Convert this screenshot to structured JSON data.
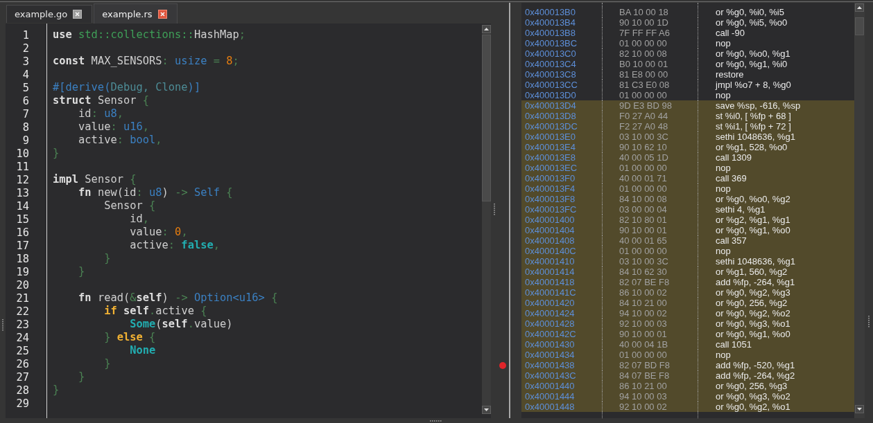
{
  "editor": {
    "tabs": [
      {
        "label": "example.go",
        "selected": false
      },
      {
        "label": "example.rs",
        "selected": true
      }
    ],
    "lines": [
      {
        "number": "1",
        "tokens": [
          {
            "kind": "keyword",
            "text": "use "
          },
          {
            "kind": "path",
            "text": "std::collections::"
          },
          {
            "kind": "plain",
            "text": "HashMap"
          },
          {
            "kind": "punct",
            "text": ";"
          }
        ]
      },
      {
        "number": "2"
      },
      {
        "number": "3",
        "tokens": [
          {
            "kind": "keyword",
            "text": "const"
          },
          {
            "kind": "plain",
            "text": " MAX_SENSORS"
          },
          {
            "kind": "punct",
            "text": ": "
          },
          {
            "kind": "type",
            "text": "usize"
          },
          {
            "kind": "punct",
            "text": " = "
          },
          {
            "kind": "number",
            "text": "8"
          },
          {
            "kind": "punct",
            "text": ";"
          }
        ]
      },
      {
        "number": "4"
      },
      {
        "number": "5",
        "tokens": [
          {
            "kind": "attribute",
            "text": "#[derive("
          },
          {
            "kind": "attr_arg",
            "text": "Debug, Clone"
          },
          {
            "kind": "attribute",
            "text": ")]"
          }
        ]
      },
      {
        "number": "6",
        "tokens": [
          {
            "kind": "keyword",
            "text": "struct"
          },
          {
            "kind": "plain",
            "text": " Sensor "
          },
          {
            "kind": "punct",
            "text": "{"
          }
        ]
      },
      {
        "number": "7",
        "tokens": [
          {
            "kind": "plain",
            "text": "    id"
          },
          {
            "kind": "punct",
            "text": ": "
          },
          {
            "kind": "type",
            "text": "u8"
          },
          {
            "kind": "punct",
            "text": ","
          }
        ]
      },
      {
        "number": "8",
        "tokens": [
          {
            "kind": "plain",
            "text": "    value"
          },
          {
            "kind": "punct",
            "text": ": "
          },
          {
            "kind": "type",
            "text": "u16"
          },
          {
            "kind": "punct",
            "text": ","
          }
        ]
      },
      {
        "number": "9",
        "tokens": [
          {
            "kind": "plain",
            "text": "    active"
          },
          {
            "kind": "punct",
            "text": ": "
          },
          {
            "kind": "type",
            "text": "bool"
          },
          {
            "kind": "punct",
            "text": ","
          }
        ]
      },
      {
        "number": "10",
        "tokens": [
          {
            "kind": "punct",
            "text": "}"
          }
        ]
      },
      {
        "number": "11"
      },
      {
        "number": "12",
        "tokens": [
          {
            "kind": "keyword",
            "text": "impl"
          },
          {
            "kind": "plain",
            "text": " Sensor "
          },
          {
            "kind": "punct",
            "text": "{"
          }
        ]
      },
      {
        "number": "13",
        "tokens": [
          {
            "kind": "keyword",
            "text": "    fn"
          },
          {
            "kind": "plain",
            "text": " new(id"
          },
          {
            "kind": "punct",
            "text": ": "
          },
          {
            "kind": "type",
            "text": "u8"
          },
          {
            "kind": "plain",
            "text": ")"
          },
          {
            "kind": "punct",
            "text": " -> "
          },
          {
            "kind": "type",
            "text": "Self"
          },
          {
            "kind": "punct",
            "text": " {"
          }
        ]
      },
      {
        "number": "14",
        "tokens": [
          {
            "kind": "plain",
            "text": "        Sensor "
          },
          {
            "kind": "punct",
            "text": "{"
          }
        ]
      },
      {
        "number": "15",
        "tokens": [
          {
            "kind": "plain",
            "text": "            id"
          },
          {
            "kind": "punct",
            "text": ","
          }
        ]
      },
      {
        "number": "16",
        "tokens": [
          {
            "kind": "plain",
            "text": "            value"
          },
          {
            "kind": "punct",
            "text": ": "
          },
          {
            "kind": "number",
            "text": "0"
          },
          {
            "kind": "punct",
            "text": ","
          }
        ]
      },
      {
        "number": "17",
        "tokens": [
          {
            "kind": "plain",
            "text": "            active"
          },
          {
            "kind": "punct",
            "text": ": "
          },
          {
            "kind": "literal",
            "text": "false"
          },
          {
            "kind": "punct",
            "text": ","
          }
        ]
      },
      {
        "number": "18",
        "tokens": [
          {
            "kind": "punct",
            "text": "        }"
          }
        ]
      },
      {
        "number": "19",
        "tokens": [
          {
            "kind": "punct",
            "text": "    }"
          }
        ]
      },
      {
        "number": "20"
      },
      {
        "number": "21",
        "tokens": [
          {
            "kind": "keyword",
            "text": "    fn"
          },
          {
            "kind": "plain",
            "text": " read("
          },
          {
            "kind": "punct",
            "text": "&"
          },
          {
            "kind": "keyword",
            "text": "self"
          },
          {
            "kind": "plain",
            "text": ")"
          },
          {
            "kind": "punct",
            "text": " -> "
          },
          {
            "kind": "type",
            "text": "Option<u16>"
          },
          {
            "kind": "punct",
            "text": " {"
          }
        ]
      },
      {
        "number": "22",
        "tokens": [
          {
            "kind": "control",
            "text": "        if "
          },
          {
            "kind": "keyword",
            "text": "self"
          },
          {
            "kind": "punct",
            "text": "."
          },
          {
            "kind": "plain",
            "text": "active "
          },
          {
            "kind": "punct",
            "text": "{"
          }
        ]
      },
      {
        "number": "23",
        "tokens": [
          {
            "kind": "literal",
            "text": "            Some"
          },
          {
            "kind": "plain",
            "text": "("
          },
          {
            "kind": "keyword",
            "text": "self"
          },
          {
            "kind": "punct",
            "text": "."
          },
          {
            "kind": "plain",
            "text": "value)"
          }
        ]
      },
      {
        "number": "24",
        "tokens": [
          {
            "kind": "punct",
            "text": "        } "
          },
          {
            "kind": "control",
            "text": "else"
          },
          {
            "kind": "punct",
            "text": " {"
          }
        ]
      },
      {
        "number": "25",
        "tokens": [
          {
            "kind": "literal",
            "text": "            None"
          }
        ]
      },
      {
        "number": "26",
        "tokens": [
          {
            "kind": "punct",
            "text": "        }"
          }
        ]
      },
      {
        "number": "27",
        "tokens": [
          {
            "kind": "punct",
            "text": "    }"
          }
        ]
      },
      {
        "number": "28",
        "tokens": [
          {
            "kind": "punct",
            "text": "}"
          }
        ]
      },
      {
        "number": "29"
      }
    ]
  },
  "disassembly": {
    "rows": [
      {
        "address": "0x400013B0",
        "bytes": "BA 10 00 18",
        "instruction": "or %g0, %i0, %i5",
        "highlighted": false,
        "breakpoint": false
      },
      {
        "address": "0x400013B4",
        "bytes": "90 10 00 1D",
        "instruction": "or %g0, %i5, %o0",
        "highlighted": false,
        "breakpoint": false
      },
      {
        "address": "0x400013B8",
        "bytes": "7F FF FF A6",
        "instruction": "call -90",
        "highlighted": false,
        "breakpoint": false
      },
      {
        "address": "0x400013BC",
        "bytes": "01 00 00 00",
        "instruction": "nop",
        "highlighted": false,
        "breakpoint": false
      },
      {
        "address": "0x400013C0",
        "bytes": "82 10 00 08",
        "instruction": "or %g0, %o0, %g1",
        "highlighted": false,
        "breakpoint": false
      },
      {
        "address": "0x400013C4",
        "bytes": "B0 10 00 01",
        "instruction": "or %g0, %g1, %i0",
        "highlighted": false,
        "breakpoint": false
      },
      {
        "address": "0x400013C8",
        "bytes": "81 E8 00 00",
        "instruction": "restore",
        "highlighted": false,
        "breakpoint": false
      },
      {
        "address": "0x400013CC",
        "bytes": "81 C3 E0 08",
        "instruction": "jmpl %o7 + 8, %g0",
        "highlighted": false,
        "breakpoint": false
      },
      {
        "address": "0x400013D0",
        "bytes": "01 00 00 00",
        "instruction": "nop",
        "highlighted": false,
        "breakpoint": false
      },
      {
        "address": "0x400013D4",
        "bytes": "9D E3 BD 98",
        "instruction": "save %sp, -616, %sp",
        "highlighted": true,
        "breakpoint": false
      },
      {
        "address": "0x400013D8",
        "bytes": "F0 27 A0 44",
        "instruction": "st %i0, [ %fp + 68 ]",
        "highlighted": true,
        "breakpoint": false
      },
      {
        "address": "0x400013DC",
        "bytes": "F2 27 A0 48",
        "instruction": "st %i1, [ %fp + 72 ]",
        "highlighted": true,
        "breakpoint": false
      },
      {
        "address": "0x400013E0",
        "bytes": "03 10 00 3C",
        "instruction": "sethi 1048636, %g1",
        "highlighted": true,
        "breakpoint": false
      },
      {
        "address": "0x400013E4",
        "bytes": "90 10 62 10",
        "instruction": "or %g1, 528, %o0",
        "highlighted": true,
        "breakpoint": false
      },
      {
        "address": "0x400013E8",
        "bytes": "40 00 05 1D",
        "instruction": "call 1309",
        "highlighted": true,
        "breakpoint": false
      },
      {
        "address": "0x400013EC",
        "bytes": "01 00 00 00",
        "instruction": "nop",
        "highlighted": true,
        "breakpoint": false
      },
      {
        "address": "0x400013F0",
        "bytes": "40 00 01 71",
        "instruction": "call 369",
        "highlighted": true,
        "breakpoint": false
      },
      {
        "address": "0x400013F4",
        "bytes": "01 00 00 00",
        "instruction": "nop",
        "highlighted": true,
        "breakpoint": false
      },
      {
        "address": "0x400013F8",
        "bytes": "84 10 00 08",
        "instruction": "or %g0, %o0, %g2",
        "highlighted": true,
        "breakpoint": false
      },
      {
        "address": "0x400013FC",
        "bytes": "03 00 00 04",
        "instruction": "sethi 4, %g1",
        "highlighted": true,
        "breakpoint": false
      },
      {
        "address": "0x40001400",
        "bytes": "82 10 80 01",
        "instruction": "or %g2, %g1, %g1",
        "highlighted": true,
        "breakpoint": false
      },
      {
        "address": "0x40001404",
        "bytes": "90 10 00 01",
        "instruction": "or %g0, %g1, %o0",
        "highlighted": true,
        "breakpoint": false
      },
      {
        "address": "0x40001408",
        "bytes": "40 00 01 65",
        "instruction": "call 357",
        "highlighted": true,
        "breakpoint": false
      },
      {
        "address": "0x4000140C",
        "bytes": "01 00 00 00",
        "instruction": "nop",
        "highlighted": true,
        "breakpoint": false
      },
      {
        "address": "0x40001410",
        "bytes": "03 10 00 3C",
        "instruction": "sethi 1048636, %g1",
        "highlighted": true,
        "breakpoint": false
      },
      {
        "address": "0x40001414",
        "bytes": "84 10 62 30",
        "instruction": "or %g1, 560, %g2",
        "highlighted": true,
        "breakpoint": false
      },
      {
        "address": "0x40001418",
        "bytes": "82 07 BE F8",
        "instruction": "add %fp, -264, %g1",
        "highlighted": true,
        "breakpoint": false
      },
      {
        "address": "0x4000141C",
        "bytes": "86 10 00 02",
        "instruction": "or %g0, %g2, %g3",
        "highlighted": true,
        "breakpoint": false
      },
      {
        "address": "0x40001420",
        "bytes": "84 10 21 00",
        "instruction": "or %g0, 256, %g2",
        "highlighted": true,
        "breakpoint": false
      },
      {
        "address": "0x40001424",
        "bytes": "94 10 00 02",
        "instruction": "or %g0, %g2, %o2",
        "highlighted": true,
        "breakpoint": false
      },
      {
        "address": "0x40001428",
        "bytes": "92 10 00 03",
        "instruction": "or %g0, %g3, %o1",
        "highlighted": true,
        "breakpoint": false
      },
      {
        "address": "0x4000142C",
        "bytes": "90 10 00 01",
        "instruction": "or %g0, %g1, %o0",
        "highlighted": true,
        "breakpoint": false
      },
      {
        "address": "0x40001430",
        "bytes": "40 00 04 1B",
        "instruction": "call 1051",
        "highlighted": true,
        "breakpoint": false
      },
      {
        "address": "0x40001434",
        "bytes": "01 00 00 00",
        "instruction": "nop",
        "highlighted": true,
        "breakpoint": false
      },
      {
        "address": "0x40001438",
        "bytes": "82 07 BD F8",
        "instruction": "add %fp, -520, %g1",
        "highlighted": true,
        "breakpoint": true
      },
      {
        "address": "0x4000143C",
        "bytes": "84 07 BE F8",
        "instruction": "add %fp, -264, %g2",
        "highlighted": true,
        "breakpoint": false
      },
      {
        "address": "0x40001440",
        "bytes": "86 10 21 00",
        "instruction": "or %g0, 256, %g3",
        "highlighted": true,
        "breakpoint": false
      },
      {
        "address": "0x40001444",
        "bytes": "94 10 00 03",
        "instruction": "or %g0, %g3, %o2",
        "highlighted": true,
        "breakpoint": false
      },
      {
        "address": "0x40001448",
        "bytes": "92 10 00 02",
        "instruction": "or %g0, %g2, %o1",
        "highlighted": true,
        "breakpoint": false
      }
    ]
  }
}
